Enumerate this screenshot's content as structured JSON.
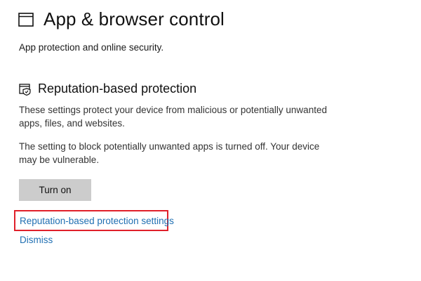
{
  "page": {
    "title": "App & browser control",
    "subtitle": "App protection and online security.",
    "title_icon": "window-icon"
  },
  "section": {
    "title": "Reputation-based protection",
    "icon": "reputation-shield-icon",
    "description": "These settings protect your device from malicious or potentially unwanted apps, files, and websites.",
    "status": "The setting to block potentially unwanted apps is turned off. Your device may be vulnerable.",
    "turn_on_label": "Turn on",
    "settings_link": "Reputation-based protection settings",
    "dismiss_link": "Dismiss"
  },
  "colors": {
    "link": "#1f6fb2",
    "button_bg": "#cccccc",
    "highlight": "#e0202a"
  }
}
